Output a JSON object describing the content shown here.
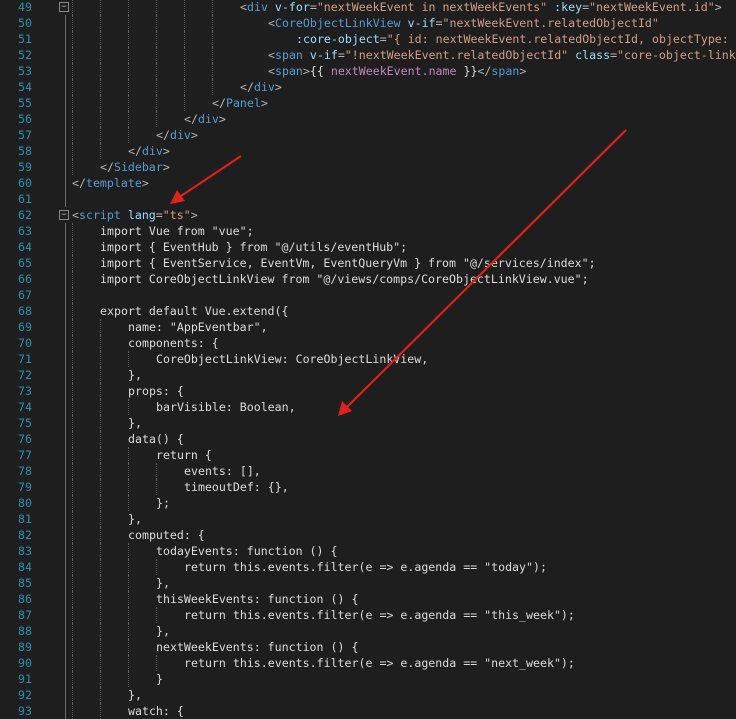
{
  "editor": {
    "colors": {
      "background": "#1e1e1e",
      "line_number": "#2b91af",
      "tag": "#569cd6",
      "attribute": "#9cdcfe",
      "string": "#d69d85",
      "text": "#dcdcdc",
      "operator": "#b4b4b4",
      "interpolation": "#c586c0",
      "annotation_arrow": "#e0201a"
    },
    "lines": [
      {
        "num": "49",
        "fold": "⊟",
        "segs": [
          {
            "c": "o",
            "t": "<"
          },
          {
            "c": "t",
            "t": "div"
          },
          {
            "c": "d",
            "t": " "
          },
          {
            "c": "a",
            "t": "v-for"
          },
          {
            "c": "o",
            "t": "="
          },
          {
            "c": "s",
            "t": "\"nextWeekEvent in nextWeekEvents\""
          },
          {
            "c": "d",
            "t": " "
          },
          {
            "c": "a",
            "t": ":key"
          },
          {
            "c": "o",
            "t": "="
          },
          {
            "c": "s",
            "t": "\"nextWeekEvent.id\""
          },
          {
            "c": "o",
            "t": ">"
          }
        ]
      },
      {
        "num": "50",
        "segs": [
          {
            "c": "o",
            "t": "<"
          },
          {
            "c": "t",
            "t": "CoreObjectLinkView"
          },
          {
            "c": "d",
            "t": " "
          },
          {
            "c": "a",
            "t": "v-if"
          },
          {
            "c": "o",
            "t": "="
          },
          {
            "c": "s",
            "t": "\"nextWeekEvent.relatedObjectId\""
          }
        ]
      },
      {
        "num": "51",
        "segs": [
          {
            "c": "a",
            "t": ":core-object"
          },
          {
            "c": "o",
            "t": "="
          },
          {
            "c": "s",
            "t": "\"{ id: nextWeekEvent.relatedObjectId, objectType:"
          }
        ]
      },
      {
        "num": "52",
        "segs": [
          {
            "c": "o",
            "t": "<"
          },
          {
            "c": "t",
            "t": "span"
          },
          {
            "c": "d",
            "t": " "
          },
          {
            "c": "a",
            "t": "v-if"
          },
          {
            "c": "o",
            "t": "="
          },
          {
            "c": "s",
            "t": "\"!nextWeekEvent.relatedObjectId\""
          },
          {
            "c": "d",
            "t": " "
          },
          {
            "c": "a",
            "t": "class"
          },
          {
            "c": "o",
            "t": "="
          },
          {
            "c": "s",
            "t": "\"core-object-link"
          }
        ]
      },
      {
        "num": "53",
        "segs": [
          {
            "c": "o",
            "t": "<"
          },
          {
            "c": "t",
            "t": "span"
          },
          {
            "c": "o",
            "t": ">"
          },
          {
            "c": "d",
            "t": "{{ "
          },
          {
            "c": "p",
            "t": "nextWeekEvent.name"
          },
          {
            "c": "d",
            "t": " }}"
          },
          {
            "c": "o",
            "t": "</"
          },
          {
            "c": "t",
            "t": "span"
          },
          {
            "c": "o",
            "t": ">"
          }
        ]
      },
      {
        "num": "54",
        "segs": [
          {
            "c": "o",
            "t": "</"
          },
          {
            "c": "t",
            "t": "div"
          },
          {
            "c": "o",
            "t": ">"
          }
        ]
      },
      {
        "num": "55",
        "segs": [
          {
            "c": "o",
            "t": "</"
          },
          {
            "c": "t",
            "t": "Panel"
          },
          {
            "c": "o",
            "t": ">"
          }
        ]
      },
      {
        "num": "56",
        "segs": [
          {
            "c": "o",
            "t": "</"
          },
          {
            "c": "t",
            "t": "div"
          },
          {
            "c": "o",
            "t": ">"
          }
        ]
      },
      {
        "num": "57",
        "segs": [
          {
            "c": "o",
            "t": "</"
          },
          {
            "c": "t",
            "t": "div"
          },
          {
            "c": "o",
            "t": ">"
          }
        ]
      },
      {
        "num": "58",
        "segs": [
          {
            "c": "o",
            "t": "</"
          },
          {
            "c": "t",
            "t": "div"
          },
          {
            "c": "o",
            "t": ">"
          }
        ]
      },
      {
        "num": "59",
        "segs": [
          {
            "c": "o",
            "t": "</"
          },
          {
            "c": "t",
            "t": "Sidebar"
          },
          {
            "c": "o",
            "t": ">"
          }
        ]
      },
      {
        "num": "60",
        "segs": [
          {
            "c": "o",
            "t": "</"
          },
          {
            "c": "t",
            "t": "template"
          },
          {
            "c": "o",
            "t": ">"
          }
        ]
      },
      {
        "num": "61",
        "segs": []
      },
      {
        "num": "62",
        "fold": "⊟",
        "segs": [
          {
            "c": "o",
            "t": "<"
          },
          {
            "c": "t",
            "t": "script"
          },
          {
            "c": "d",
            "t": " "
          },
          {
            "c": "a",
            "t": "lang"
          },
          {
            "c": "o",
            "t": "="
          },
          {
            "c": "s",
            "t": "\"ts\""
          },
          {
            "c": "o",
            "t": ">"
          }
        ]
      },
      {
        "num": "63",
        "segs": [
          {
            "c": "d",
            "t": "import Vue from \"vue\";"
          }
        ]
      },
      {
        "num": "64",
        "segs": [
          {
            "c": "d",
            "t": "import { EventHub } from \"@/utils/eventHub\";"
          }
        ]
      },
      {
        "num": "65",
        "segs": [
          {
            "c": "d",
            "t": "import { EventService, EventVm, EventQueryVm } from \"@/services/index\";"
          }
        ]
      },
      {
        "num": "66",
        "segs": [
          {
            "c": "d",
            "t": "import CoreObjectLinkView from \"@/views/comps/CoreObjectLinkView.vue\";"
          }
        ]
      },
      {
        "num": "67",
        "segs": []
      },
      {
        "num": "68",
        "segs": [
          {
            "c": "d",
            "t": "export default Vue.extend({"
          }
        ]
      },
      {
        "num": "69",
        "segs": [
          {
            "c": "d",
            "t": "name: \"AppEventbar\","
          }
        ]
      },
      {
        "num": "70",
        "segs": [
          {
            "c": "d",
            "t": "components: {"
          }
        ]
      },
      {
        "num": "71",
        "segs": [
          {
            "c": "d",
            "t": "CoreObjectLinkView: CoreObjectLinkView,"
          }
        ]
      },
      {
        "num": "72",
        "segs": [
          {
            "c": "d",
            "t": "},"
          }
        ]
      },
      {
        "num": "73",
        "segs": [
          {
            "c": "d",
            "t": "props: {"
          }
        ]
      },
      {
        "num": "74",
        "segs": [
          {
            "c": "d",
            "t": "barVisible: Boolean,"
          }
        ]
      },
      {
        "num": "75",
        "segs": [
          {
            "c": "d",
            "t": "},"
          }
        ]
      },
      {
        "num": "76",
        "segs": [
          {
            "c": "d",
            "t": "data() {"
          }
        ]
      },
      {
        "num": "77",
        "segs": [
          {
            "c": "d",
            "t": "return {"
          }
        ]
      },
      {
        "num": "78",
        "segs": [
          {
            "c": "d",
            "t": "events: [],"
          }
        ]
      },
      {
        "num": "79",
        "segs": [
          {
            "c": "d",
            "t": "timeoutDef: {},"
          }
        ]
      },
      {
        "num": "80",
        "segs": [
          {
            "c": "d",
            "t": "};"
          }
        ]
      },
      {
        "num": "81",
        "segs": [
          {
            "c": "d",
            "t": "},"
          }
        ]
      },
      {
        "num": "82",
        "segs": [
          {
            "c": "d",
            "t": "computed: {"
          }
        ]
      },
      {
        "num": "83",
        "segs": [
          {
            "c": "d",
            "t": "todayEvents: function () {"
          }
        ]
      },
      {
        "num": "84",
        "segs": [
          {
            "c": "d",
            "t": "return this.events.filter(e => e.agenda == \"today\");"
          }
        ]
      },
      {
        "num": "85",
        "segs": [
          {
            "c": "d",
            "t": "},"
          }
        ]
      },
      {
        "num": "86",
        "segs": [
          {
            "c": "d",
            "t": "thisWeekEvents: function () {"
          }
        ]
      },
      {
        "num": "87",
        "segs": [
          {
            "c": "d",
            "t": "return this.events.filter(e => e.agenda == \"this_week\");"
          }
        ]
      },
      {
        "num": "88",
        "segs": [
          {
            "c": "d",
            "t": "},"
          }
        ]
      },
      {
        "num": "89",
        "segs": [
          {
            "c": "d",
            "t": "nextWeekEvents: function () {"
          }
        ]
      },
      {
        "num": "90",
        "segs": [
          {
            "c": "d",
            "t": "return this.events.filter(e => e.agenda == \"next_week\");"
          }
        ]
      },
      {
        "num": "91",
        "segs": [
          {
            "c": "d",
            "t": "}"
          }
        ]
      },
      {
        "num": "92",
        "segs": [
          {
            "c": "d",
            "t": "},"
          }
        ]
      },
      {
        "num": "93",
        "segs": [
          {
            "c": "d",
            "t": "watch: {"
          }
        ]
      }
    ]
  }
}
